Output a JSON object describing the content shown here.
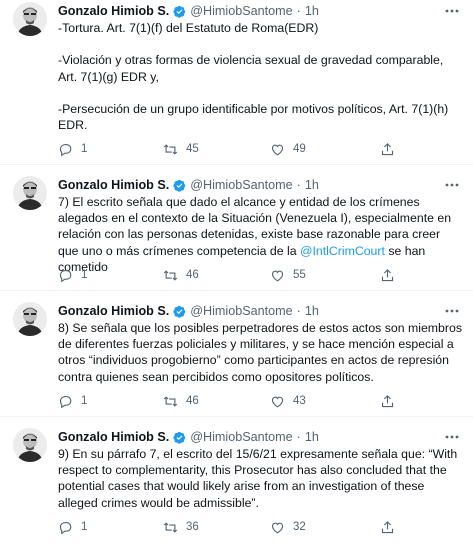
{
  "tweets": [
    {
      "author_name": "Gonzalo Himiob S.",
      "author_handle": "@HimiobSantome",
      "separator": "·",
      "time": "1h",
      "text": "-Tortura. Art. 7(1)(f) del Estatuto de Roma(EDR)\n\n-Violación y otras formas de violencia sexual de gravedad comparable, Art. 7(1)(g) EDR y,\n\n-Persecución de un grupo identificable por motivos políticos, Art. 7(1)(h) EDR.",
      "replies": "1",
      "retweets": "45",
      "likes": "49"
    },
    {
      "author_name": "Gonzalo Himiob S.",
      "author_handle": "@HimiobSantome",
      "separator": "·",
      "time": "1h",
      "text_before": "7) El escrito señala que dado el alcance y entidad de los crímenes alegados en el contexto de la Situación (Venezuela I), especialmente en relación con las personas detenidas, existe base razonable para creer que uno o más crímenes competencia de la ",
      "mention": "@IntlCrimCourt",
      "text_after": " se han cometido",
      "replies": "1",
      "retweets": "46",
      "likes": "55"
    },
    {
      "author_name": "Gonzalo Himiob S.",
      "author_handle": "@HimiobSantome",
      "separator": "·",
      "time": "1h",
      "text": "8) Se señala que los posibles perpetradores de estos actos son miembros de diferentes fuerzas policiales y militares, y se hace mención especial a otros “individuos progobierno” como participantes en actos de represión contra quienes sean percibidos como opositores políticos.",
      "replies": "1",
      "retweets": "46",
      "likes": "43"
    },
    {
      "author_name": "Gonzalo Himiob S.",
      "author_handle": "@HimiobSantome",
      "separator": "·",
      "time": "1h",
      "text": "9) En su párrafo 7, el escrito del 15/6/21 expresamente señala que: “With respect to complementarity, this Prosecutor has also concluded that the potential cases that would likely arise from an investigation of these alleged crimes would be admissible”.",
      "replies": "1",
      "retweets": "36",
      "likes": "32"
    }
  ],
  "colors": {
    "text": "#0f1419",
    "secondary": "#536471",
    "link": "#1d9bf0",
    "divider": "#eff3f4"
  },
  "icons": [
    "avatar",
    "verified-badge-icon",
    "more-options-icon",
    "reply-icon",
    "retweet-icon",
    "like-icon",
    "share-icon"
  ]
}
